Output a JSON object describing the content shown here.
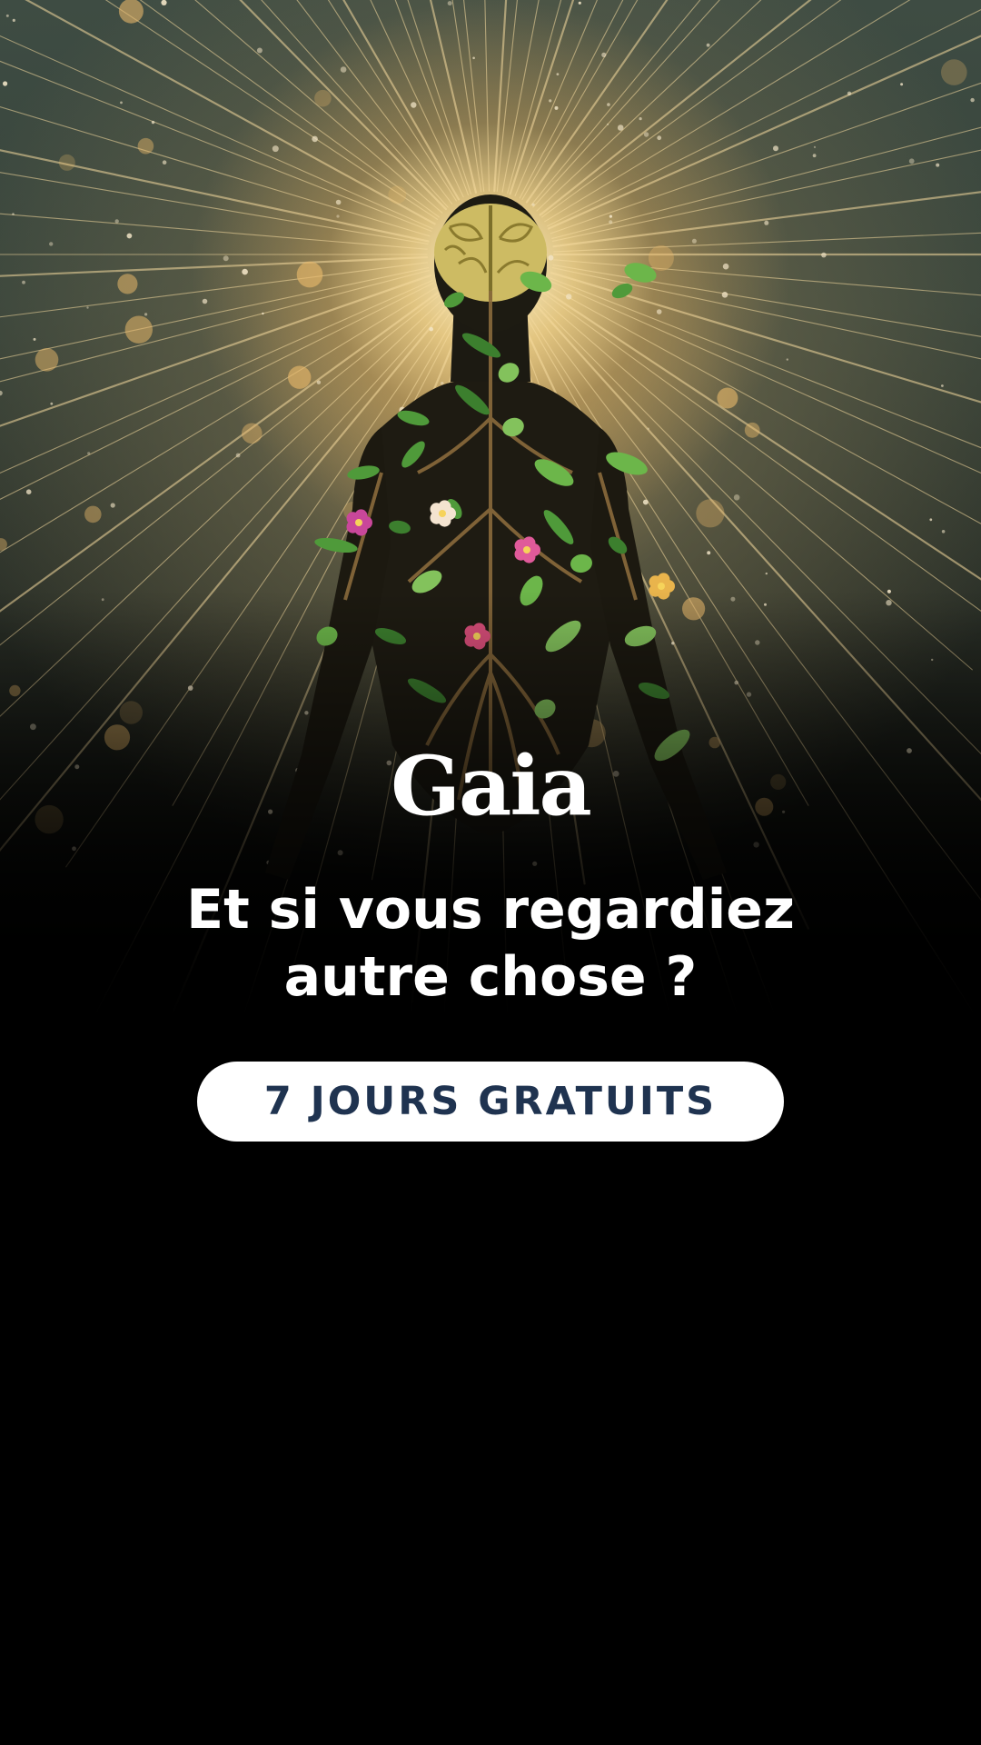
{
  "app": {
    "logo_text": "Gaia"
  },
  "promo": {
    "headline_line1": "Et si vous regardiez",
    "headline_line2": "autre chose ?",
    "cta_label": "7 JOURS GRATUITS"
  },
  "colors": {
    "background": "#000000",
    "text": "#ffffff",
    "button_background": "#ffffff",
    "button_text": "#1f3350"
  },
  "icons": {
    "hero_artwork": "human-silhouette-with-plants-and-glowing-brain-icon"
  }
}
